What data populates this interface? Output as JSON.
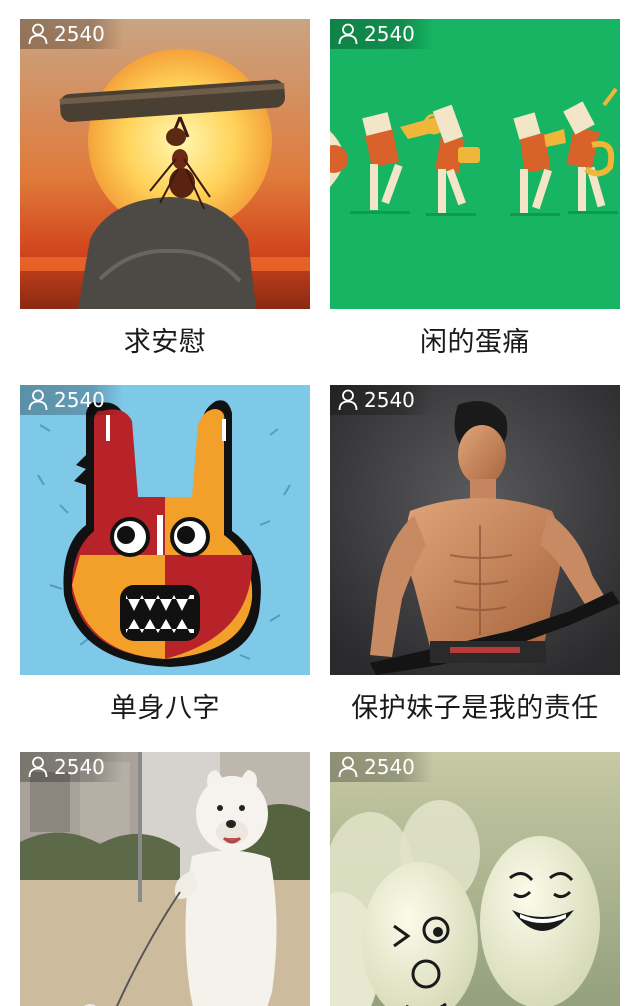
{
  "cards": [
    {
      "count": "2540",
      "title": "求安慰",
      "image": "ant-lifting-log-at-sunset"
    },
    {
      "count": "2540",
      "title": "闲的蛋痛",
      "image": "cartoon-marching-band-green"
    },
    {
      "count": "2540",
      "title": "单身八字",
      "image": "red-orange-rabbit-monster"
    },
    {
      "count": "2540",
      "title": "保护妹子是我的责任",
      "image": "shirtless-man-with-strap"
    },
    {
      "count": "2540",
      "title": "",
      "image": "person-in-dog-costume-walking-dog"
    },
    {
      "count": "2540",
      "title": "",
      "image": "eggs-with-drawn-faces"
    }
  ],
  "icons": {
    "count_icon": "user-icon"
  },
  "colors": {
    "badge_text": "#ffffff",
    "caption_text": "#1a1a1a",
    "background": "#ffffff"
  }
}
